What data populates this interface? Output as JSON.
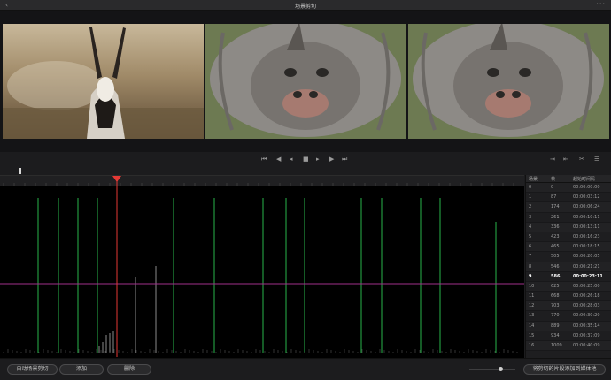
{
  "window": {
    "title": "场景剪切",
    "back_icon": "chevron-left-icon",
    "menu_icon": "more-icon"
  },
  "viewer": {
    "frames": [
      {
        "name": "previous-frame",
        "subject": "antelope"
      },
      {
        "name": "current-frame",
        "subject": "rhinoceros"
      },
      {
        "name": "next-frame",
        "subject": "rhinoceros"
      }
    ]
  },
  "transport": {
    "buttons": [
      "jump-start-icon",
      "step-back-icon",
      "play-reverse-icon",
      "stop-icon",
      "play-icon",
      "step-forward-icon",
      "jump-end-icon"
    ],
    "right_buttons": [
      "next-cut-icon",
      "prev-cut-icon",
      "cut-icon",
      "list-icon"
    ]
  },
  "graph": {
    "playhead_color": "#e53935",
    "threshold_color": "#a0308a",
    "cut_color": "#29b34a"
  },
  "cuts": {
    "headers": {
      "index": "场景",
      "frame": "帧",
      "start": "起始时间码"
    },
    "selected": 9,
    "rows": [
      {
        "index": "0",
        "frame": "0",
        "start": "00:00:00:00"
      },
      {
        "index": "1",
        "frame": "87",
        "start": "00:00:03:12"
      },
      {
        "index": "2",
        "frame": "174",
        "start": "00:00:06:24"
      },
      {
        "index": "3",
        "frame": "261",
        "start": "00:00:10:11"
      },
      {
        "index": "4",
        "frame": "336",
        "start": "00:00:13:11"
      },
      {
        "index": "5",
        "frame": "423",
        "start": "00:00:16:23"
      },
      {
        "index": "6",
        "frame": "465",
        "start": "00:00:18:15"
      },
      {
        "index": "7",
        "frame": "505",
        "start": "00:00:20:05"
      },
      {
        "index": "8",
        "frame": "546",
        "start": "00:00:21:21"
      },
      {
        "index": "9",
        "frame": "586",
        "start": "00:00:23:11"
      },
      {
        "index": "10",
        "frame": "625",
        "start": "00:00:25:00"
      },
      {
        "index": "11",
        "frame": "668",
        "start": "00:00:26:18"
      },
      {
        "index": "12",
        "frame": "703",
        "start": "00:00:28:03"
      },
      {
        "index": "13",
        "frame": "770",
        "start": "00:00:30:20"
      },
      {
        "index": "14",
        "frame": "889",
        "start": "00:00:35:14"
      },
      {
        "index": "15",
        "frame": "934",
        "start": "00:00:37:09"
      },
      {
        "index": "16",
        "frame": "1009",
        "start": "00:00:40:09"
      }
    ]
  },
  "bottom": {
    "auto_detect": "自动场景剪切",
    "add": "添加",
    "delete": "删除",
    "add_to_media_pool": "将剪切的片段添加到媒体池"
  }
}
